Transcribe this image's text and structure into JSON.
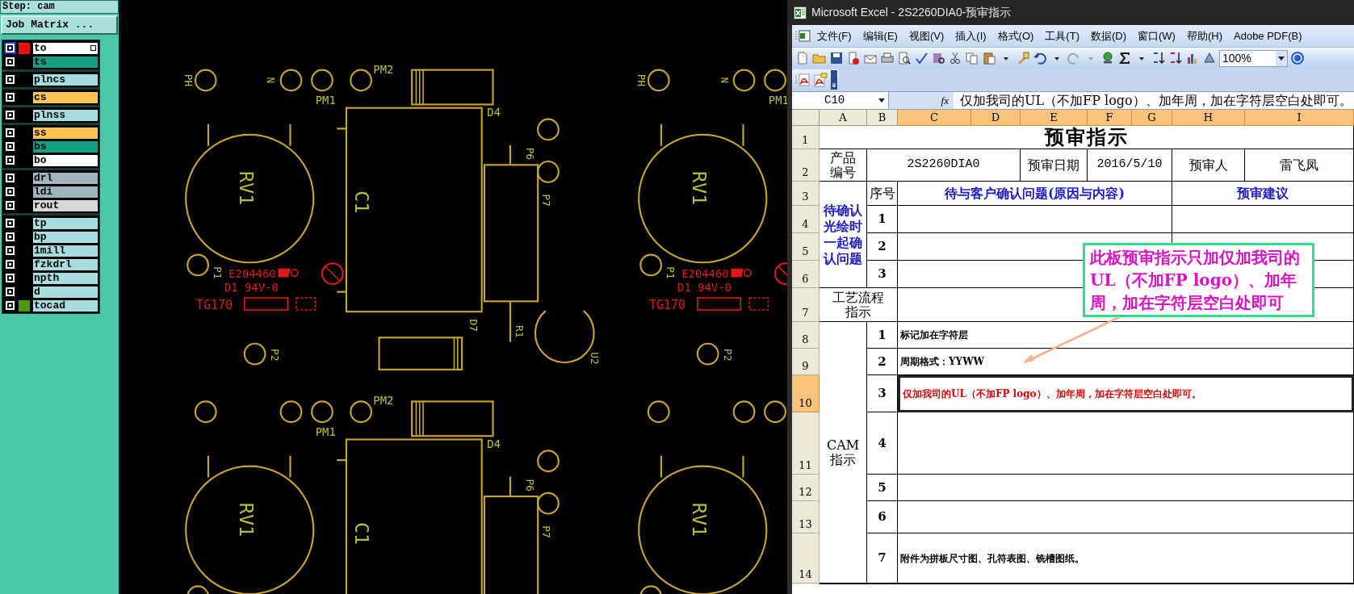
{
  "step": "Step: cam",
  "job_matrix_button": "Job Matrix ...",
  "layer_groups": [
    {
      "layers": [
        {
          "name": "to",
          "color": "#ffffff",
          "swatch": {
            "color": "#e81010"
          },
          "selected": true
        },
        {
          "name": "ts",
          "color": "#12a080",
          "selected": false
        }
      ]
    },
    {
      "layers": [
        {
          "name": "plncs",
          "color": "#a6dede",
          "selected": false
        }
      ]
    },
    {
      "layers": [
        {
          "name": "cs",
          "color": "#fcc454",
          "selected": false
        }
      ]
    },
    {
      "layers": [
        {
          "name": "plnss",
          "color": "#a6dede",
          "selected": false
        }
      ]
    },
    {
      "layers": [
        {
          "name": "ss",
          "color": "#fcc454",
          "selected": false
        },
        {
          "name": "bs",
          "color": "#12a080",
          "selected": false
        },
        {
          "name": "bo",
          "color": "#ffffff",
          "selected": false
        }
      ]
    },
    {
      "layers": [
        {
          "name": "drl",
          "color": "#9fb4bc",
          "selected": false
        },
        {
          "name": "ldi",
          "color": "#9fb4bc",
          "selected": false
        },
        {
          "name": "rout",
          "color": "#d8d8d8",
          "selected": false
        }
      ]
    },
    {
      "layers": [
        {
          "name": "tp",
          "color": "#a6dede",
          "selected": false
        },
        {
          "name": "bp",
          "color": "#a6dede",
          "selected": false
        },
        {
          "name": "1mill",
          "color": "#a6dede",
          "selected": false
        },
        {
          "name": "fzkdrl",
          "color": "#a6dede",
          "selected": false
        },
        {
          "name": "npth",
          "color": "#a6dede",
          "selected": false
        },
        {
          "name": "d",
          "color": "#a6dede",
          "selected": false
        },
        {
          "name": "tocad",
          "color": "#a6dede",
          "swatch": {
            "color": "#4a9a10"
          },
          "selected": false
        }
      ]
    }
  ],
  "pcb_units": [
    {
      "labels": [
        {
          "text": "PH",
          "kind": "ref"
        },
        {
          "text": "N",
          "kind": "ref"
        },
        {
          "text": "PM2",
          "kind": "ref"
        },
        {
          "text": "PM1",
          "kind": "ref"
        },
        {
          "text": "D4",
          "kind": "ref"
        },
        {
          "text": "P6",
          "kind": "ref"
        },
        {
          "text": "RV1",
          "kind": "ref"
        },
        {
          "text": "C1",
          "kind": "ref"
        },
        {
          "text": "P7",
          "kind": "ref"
        },
        {
          "text": "P1",
          "kind": "ref"
        },
        {
          "text": "E204460",
          "kind": "marking"
        },
        {
          "text": "D1 94V-0",
          "kind": "marking"
        },
        {
          "text": "TG170",
          "kind": "marking"
        },
        {
          "text": "D7",
          "kind": "ref"
        },
        {
          "text": "R1",
          "kind": "ref"
        },
        {
          "text": "P2",
          "kind": "ref"
        },
        {
          "text": "U2",
          "kind": "ref"
        }
      ]
    },
    {
      "labels": [
        {
          "text": "PH",
          "kind": "ref"
        },
        {
          "text": "N",
          "kind": "ref"
        },
        {
          "text": "PM1",
          "kind": "ref"
        },
        {
          "text": "RV1",
          "kind": "ref"
        },
        {
          "text": "P1",
          "kind": "ref"
        },
        {
          "text": "E204460",
          "kind": "marking"
        },
        {
          "text": "D1 94V-0",
          "kind": "marking"
        },
        {
          "text": "TG170",
          "kind": "marking"
        },
        {
          "text": "P2",
          "kind": "ref"
        }
      ]
    },
    {
      "labels": [
        {
          "text": "PM2",
          "kind": "ref"
        },
        {
          "text": "PM1",
          "kind": "ref"
        },
        {
          "text": "D4",
          "kind": "ref"
        },
        {
          "text": "P6",
          "kind": "ref"
        },
        {
          "text": "RV1",
          "kind": "ref"
        },
        {
          "text": "C1",
          "kind": "ref"
        },
        {
          "text": "P7",
          "kind": "ref"
        }
      ]
    },
    {
      "labels": [
        {
          "text": "RV1",
          "kind": "ref"
        }
      ]
    }
  ],
  "excel": {
    "title": "Microsoft Excel - 2S2260DIA0-预审指示",
    "menu": [
      "文件(F)",
      "编辑(E)",
      "视图(V)",
      "插入(I)",
      "格式(O)",
      "工具(T)",
      "数据(D)",
      "窗口(W)",
      "帮助(H)",
      "Adobe PDF(B)"
    ],
    "zoom": "100%",
    "name_box": "C10",
    "function_label": "fx",
    "formula": "仅加我司的UL（不加FP logo）、加年周，加在字符层空白处即可。",
    "columns": [
      {
        "label": "A",
        "selected": false
      },
      {
        "label": "B",
        "selected": false
      },
      {
        "label": "C",
        "selected": true
      },
      {
        "label": "D",
        "selected": true
      },
      {
        "label": "E",
        "selected": true
      },
      {
        "label": "F",
        "selected": true
      },
      {
        "label": "G",
        "selected": true
      },
      {
        "label": "H",
        "selected": true
      },
      {
        "label": "I",
        "selected": true
      }
    ],
    "rows": [
      {
        "label": "1",
        "selected": false
      },
      {
        "label": "2",
        "selected": false
      },
      {
        "label": "3",
        "selected": false
      },
      {
        "label": "4",
        "selected": false
      },
      {
        "label": "5",
        "selected": false
      },
      {
        "label": "6",
        "selected": false
      },
      {
        "label": "7",
        "selected": false
      },
      {
        "label": "8",
        "selected": false
      },
      {
        "label": "9",
        "selected": false
      },
      {
        "label": "10",
        "selected": true
      },
      {
        "label": "11",
        "selected": false
      },
      {
        "label": "12",
        "selected": false
      },
      {
        "label": "13",
        "selected": false
      },
      {
        "label": "14",
        "selected": false
      }
    ],
    "cells": [
      {
        "text": "预审指示",
        "kind": "title",
        "selected": false
      },
      {
        "text": "产品编号",
        "kind": "label",
        "selected": false
      },
      {
        "text": "2S2260DIA0",
        "kind": "value",
        "selected": false
      },
      {
        "text": "预审日期",
        "kind": "label",
        "selected": false
      },
      {
        "text": "2016/5/10",
        "kind": "value",
        "selected": false
      },
      {
        "text": "预审人",
        "kind": "label",
        "selected": false
      },
      {
        "text": "雷飞凤",
        "kind": "label",
        "selected": false
      },
      {
        "text": "待确认光绘时一起确认问题",
        "kind": "heading",
        "selected": false
      },
      {
        "text": "序号",
        "kind": "label",
        "selected": false
      },
      {
        "text": "待与客户确认问题(原因与内容)",
        "kind": "heading",
        "selected": false
      },
      {
        "text": "预审建议",
        "kind": "heading",
        "selected": false
      },
      {
        "text": "1",
        "kind": "number",
        "selected": false
      },
      {
        "text": "2",
        "kind": "number",
        "selected": false
      },
      {
        "text": "3",
        "kind": "number",
        "selected": false
      },
      {
        "text": "工艺流程指示",
        "kind": "label",
        "selected": false
      },
      {
        "text": "CAM指示",
        "kind": "label",
        "selected": false
      },
      {
        "text": "1",
        "kind": "number",
        "selected": false
      },
      {
        "text": "标记加在字符层",
        "kind": "note",
        "selected": false
      },
      {
        "text": "2",
        "kind": "number",
        "selected": false
      },
      {
        "text": "周期格式：YYWW",
        "kind": "note",
        "selected": false
      },
      {
        "text": "3",
        "kind": "number",
        "selected": false
      },
      {
        "text": "仅加我司的UL（不加FP logo）、加年周，加在字符层空白处即可。",
        "kind": "alert",
        "selected": true
      },
      {
        "text": "4",
        "kind": "number",
        "selected": false
      },
      {
        "text": "5",
        "kind": "number",
        "selected": false
      },
      {
        "text": "6",
        "kind": "number",
        "selected": false
      },
      {
        "text": "7",
        "kind": "number",
        "selected": false
      },
      {
        "text": "附件为拼板尺寸图、孔符表图、铣槽图纸。",
        "kind": "note",
        "selected": false
      }
    ],
    "callout": "此板预审指示只加仅加我司的UL（不加FP logo）、加年周，加在字符层空白处即可"
  }
}
